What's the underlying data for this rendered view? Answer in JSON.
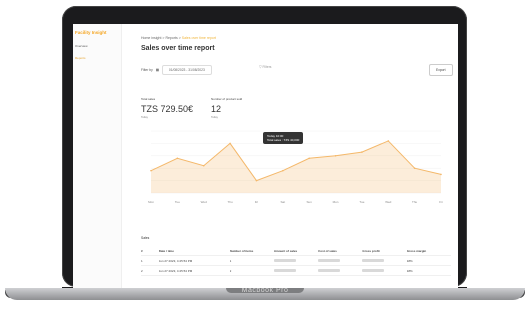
{
  "sidebar": {
    "logo": "Facility Insight",
    "items": [
      {
        "label": "Overview"
      },
      {
        "label": "Reports"
      }
    ]
  },
  "header": {
    "breadcrumb": {
      "a": "Home insight",
      "sep1": ">",
      "b": "Reports",
      "sep2": ">",
      "c": "Sales over time report"
    },
    "title": "Sales over time report"
  },
  "filters": {
    "label": "Filter by",
    "date_range": "01/08/2023 - 31/08/2023",
    "filter_label": "Filters",
    "export_label": "Export"
  },
  "kpis": [
    {
      "label": "Total sales",
      "value": "TZS 729.50€",
      "sub": "Today"
    },
    {
      "label": "Number of product sold",
      "value": "12",
      "sub": "Today"
    }
  ],
  "chart_data": {
    "type": "area",
    "categories": [
      "Mon",
      "Tue",
      "Wed",
      "Thu",
      "Fri",
      "Sat",
      "Sun",
      "Mon",
      "Tue",
      "Wed",
      "Thu",
      "Fri"
    ],
    "values": [
      18,
      28,
      22,
      40,
      10,
      18,
      28,
      30,
      33,
      42,
      20,
      15
    ],
    "ylim": [
      0,
      50
    ],
    "yticks": [
      "",
      "",
      "",
      "",
      "",
      ""
    ],
    "accent": "#f4b86a",
    "tooltip": {
      "title": "Today 10:00",
      "value": "Total sales : TZS 40,000"
    }
  },
  "table": {
    "title": "Sales",
    "headers": [
      "#",
      "Date / time",
      "Number of items",
      "Amount of sales",
      "Cost of sales",
      "Gross profit",
      "Gross margin"
    ],
    "rows": [
      [
        "1",
        "Jun 27 2023, 4:45:54 PM",
        "1",
        "",
        "",
        "",
        "18%"
      ],
      [
        "2",
        "Jun 27 2023, 4:45:54 PM",
        "2",
        "",
        "",
        "",
        "18%"
      ]
    ]
  },
  "device": {
    "label": "Macbook Pro"
  }
}
